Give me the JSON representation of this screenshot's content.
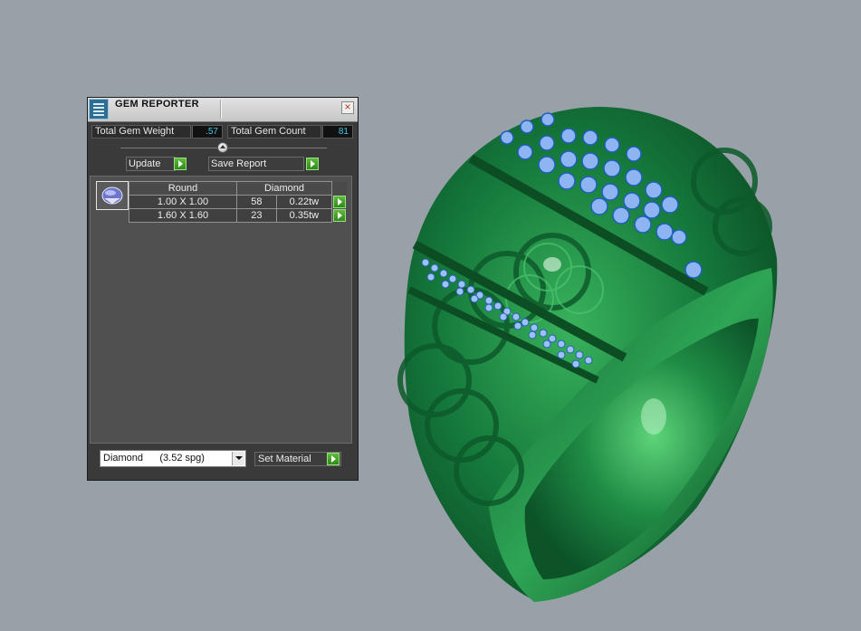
{
  "viewport": {
    "background_color": "#99a1a8",
    "ring_color": "#1a7a3e",
    "gem_color": "#8fb4f2"
  },
  "panel": {
    "title": "GEM REPORTER",
    "close_icon": "close-icon",
    "app_icon": "gem-reporter-icon",
    "total_weight_label": "Total Gem Weight",
    "total_weight_value": ".57",
    "total_count_label": "Total Gem Count",
    "total_count_value": "81",
    "update_label": "Update",
    "save_report_label": "Save Report",
    "table": {
      "col_shape": "Round",
      "col_material": "Diamond",
      "rows": [
        {
          "size": "1.00 X 1.00",
          "count": "58",
          "weight": "0.22tw"
        },
        {
          "size": "1.60 X 1.60",
          "count": "23",
          "weight": "0.35tw"
        }
      ]
    },
    "material_select_value": "Diamond      (3.52 spg)",
    "set_material_label": "Set Material",
    "accent_color": "#3fa128"
  }
}
